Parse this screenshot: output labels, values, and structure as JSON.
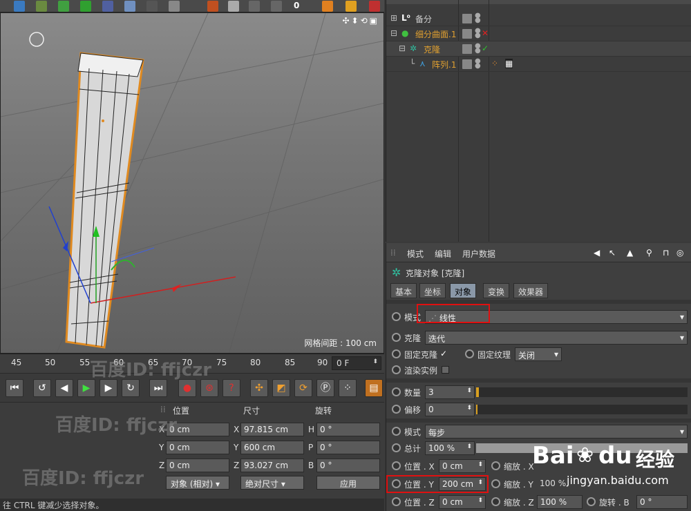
{
  "toolbar": {
    "frame_number": "0"
  },
  "viewport": {
    "grid_spacing": "网格间距 : 100 cm"
  },
  "object_manager": {
    "objects": [
      {
        "name": "备分",
        "color": "#dddddd"
      },
      {
        "name": "细分曲面.1",
        "color": "#e0a030"
      },
      {
        "name": "克隆",
        "color": "#e0a030"
      },
      {
        "name": "阵列.1",
        "color": "#e0a030"
      }
    ]
  },
  "attribute_manager": {
    "menu": [
      "模式",
      "编辑",
      "用户数据"
    ],
    "title": "克隆对象 [克隆]",
    "tabs": [
      "基本",
      "坐标",
      "对象",
      "变换",
      "效果器"
    ],
    "active_tab": "对象",
    "mode_label": "模式",
    "mode_value": "线性",
    "clone_label": "克隆",
    "clone_value": "迭代",
    "fixed_clone_label": "固定克隆",
    "fixed_texture_label": "固定纹理",
    "fixed_texture_value": "关闭",
    "render_instance_label": "渲染实例",
    "count_label": "数量",
    "count_value": "3",
    "offset_label": "偏移",
    "offset_value": "0",
    "step_mode_label": "模式",
    "step_mode_value": "每步",
    "total_label": "总计",
    "total_value": "100 %",
    "pos_x_label": "位置 . X",
    "pos_x_value": "0 cm",
    "pos_y_label": "位置 . Y",
    "pos_y_value": "200 cm",
    "pos_z_label": "位置 . Z",
    "pos_z_value": "0 cm",
    "scale_x_label": "缩放 . X",
    "scale_y_label": "缩放 . Y",
    "scale_y_value": "100 %",
    "scale_z_label": "缩放 . Z",
    "scale_z_value": "100 %",
    "rot_b_label": "旋转 . B",
    "rot_b_value": "0 °"
  },
  "timeline": {
    "ticks": [
      "45",
      "50",
      "55",
      "60",
      "65",
      "70",
      "75",
      "80",
      "85",
      "90"
    ],
    "current_frame": "0 F"
  },
  "coord_manager": {
    "headers": [
      "位置",
      "尺寸",
      "旋转"
    ],
    "rows": [
      {
        "axis": "X",
        "pos": "0 cm",
        "size_axis": "X",
        "size": "97.815 cm",
        "rot_axis": "H",
        "rot": "0 °"
      },
      {
        "axis": "Y",
        "pos": "0 cm",
        "size_axis": "Y",
        "size": "600 cm",
        "rot_axis": "P",
        "rot": "0 °"
      },
      {
        "axis": "Z",
        "pos": "0 cm",
        "size_axis": "Z",
        "size": "93.027 cm",
        "rot_axis": "B",
        "rot": "0 °"
      }
    ],
    "mode_dropdown": "对象 (相对)",
    "size_dropdown": "绝对尺寸",
    "apply_button": "应用"
  },
  "status_bar": "往 CTRL 键减少选择对象。",
  "watermarks": [
    "百度ID: ffjczr",
    "百度ID: ffjczr",
    "百度ID: ffjczr"
  ],
  "baidu": {
    "brand": "Bai",
    "brand2": "du",
    "jingyan": "经验",
    "url": "jingyan.baidu.com"
  }
}
